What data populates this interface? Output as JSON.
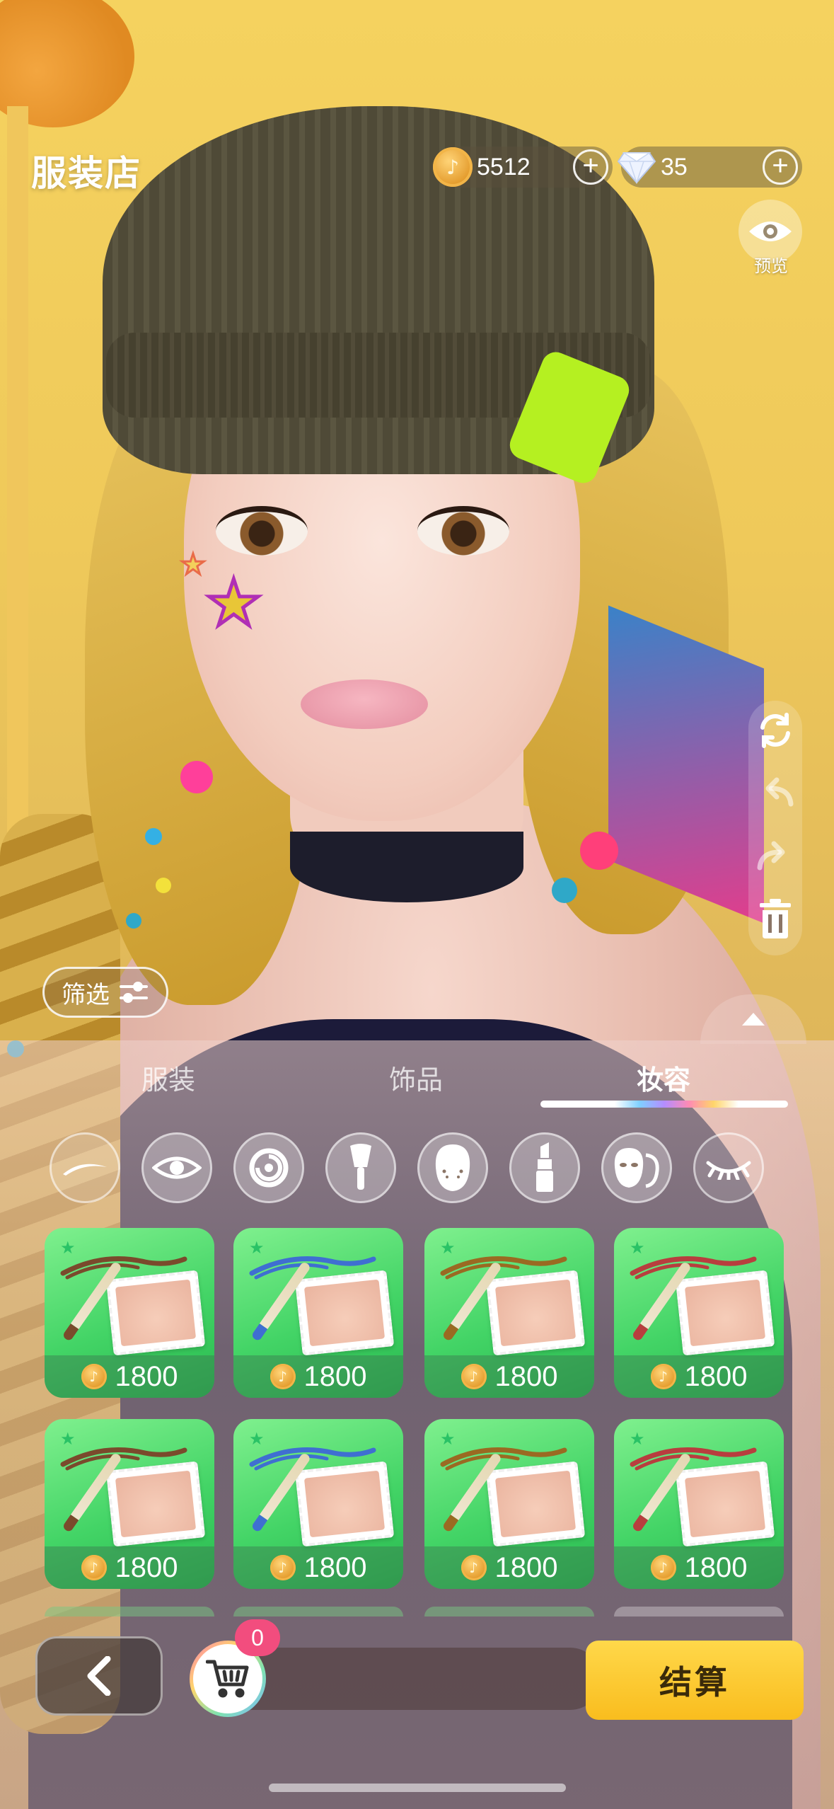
{
  "header": {
    "title": "服装店",
    "gold": {
      "value": "5512",
      "icon": "music-coin-icon"
    },
    "diamond": {
      "value": "35",
      "icon": "diamond-icon"
    },
    "preview_label": "预览"
  },
  "filter": {
    "label": "筛选"
  },
  "tabs": [
    {
      "label": "服装",
      "active": false
    },
    {
      "label": "饰品",
      "active": false
    },
    {
      "label": "妆容",
      "active": true
    }
  ],
  "categories": [
    {
      "icon": "eyebrow-icon",
      "selected": true
    },
    {
      "icon": "eye-icon",
      "selected": false
    },
    {
      "icon": "contact-lens-icon",
      "selected": false
    },
    {
      "icon": "makeup-brush-icon",
      "selected": false
    },
    {
      "icon": "face-icon",
      "selected": false
    },
    {
      "icon": "lipstick-icon",
      "selected": false
    },
    {
      "icon": "face-mask-icon",
      "selected": false
    },
    {
      "icon": "eyelash-icon",
      "selected": false
    }
  ],
  "items": [
    {
      "price": "1800",
      "color": "#7a4a2c"
    },
    {
      "price": "1800",
      "color": "#3f6fd1"
    },
    {
      "price": "1800",
      "color": "#9a6a22"
    },
    {
      "price": "1800",
      "color": "#b83e3e"
    },
    {
      "price": "1800",
      "color": "#7a4a2c"
    },
    {
      "price": "1800",
      "color": "#3f6fd1"
    },
    {
      "price": "1800",
      "color": "#9a6a22"
    },
    {
      "price": "1800",
      "color": "#b83e3e"
    }
  ],
  "cart": {
    "count": "0"
  },
  "checkout_label": "结算",
  "colors": {
    "accent": "#f9bd1e",
    "badge": "#f24d7e",
    "card_green": "#43d466"
  }
}
